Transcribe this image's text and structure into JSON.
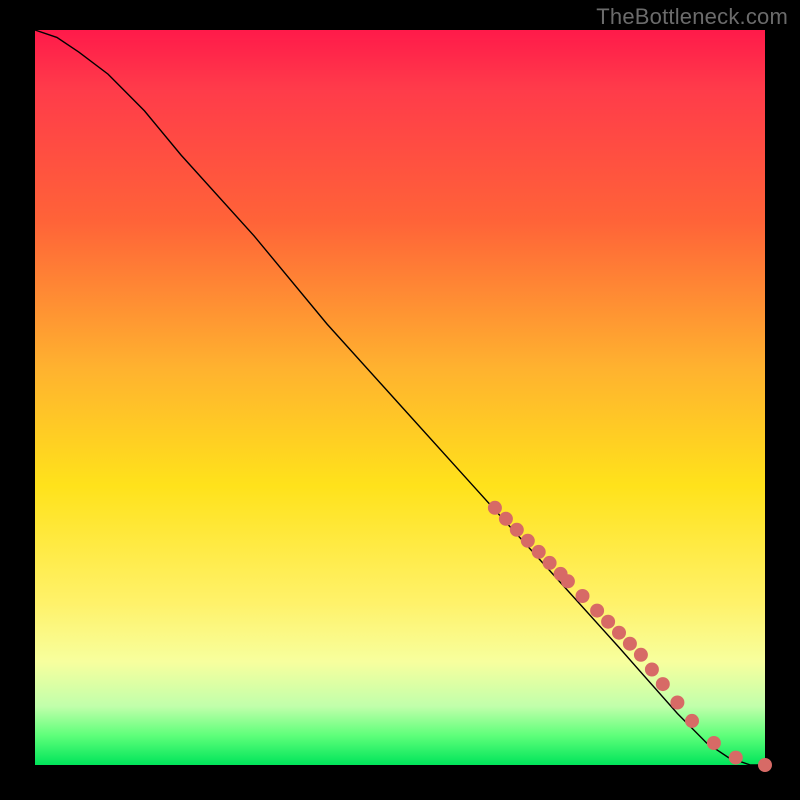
{
  "watermark": "TheBottleneck.com",
  "chart_data": {
    "type": "line",
    "title": "",
    "xlabel": "",
    "ylabel": "",
    "xlim": [
      0,
      100
    ],
    "ylim": [
      0,
      100
    ],
    "curve": {
      "x": [
        0,
        3,
        6,
        10,
        15,
        20,
        30,
        40,
        50,
        60,
        70,
        80,
        88,
        92,
        95,
        98,
        100
      ],
      "y": [
        100,
        99,
        97,
        94,
        89,
        83,
        72,
        60,
        49,
        38,
        27,
        16,
        7,
        3,
        1,
        0,
        0
      ]
    },
    "points": {
      "x": [
        63,
        64.5,
        66,
        67.5,
        69,
        70.5,
        72,
        73,
        75,
        77,
        78.5,
        80,
        81.5,
        83,
        84.5,
        86,
        88,
        90,
        93,
        96,
        100
      ],
      "y": [
        35,
        33.5,
        32,
        30.5,
        29,
        27.5,
        26,
        25,
        23,
        21,
        19.5,
        18,
        16.5,
        15,
        13,
        11,
        8.5,
        6,
        3,
        1,
        0
      ]
    },
    "colors": {
      "gradient_top": "#ff1a4a",
      "gradient_bottom": "#00e45a",
      "point": "#d76a66",
      "curve": "#000000"
    }
  }
}
